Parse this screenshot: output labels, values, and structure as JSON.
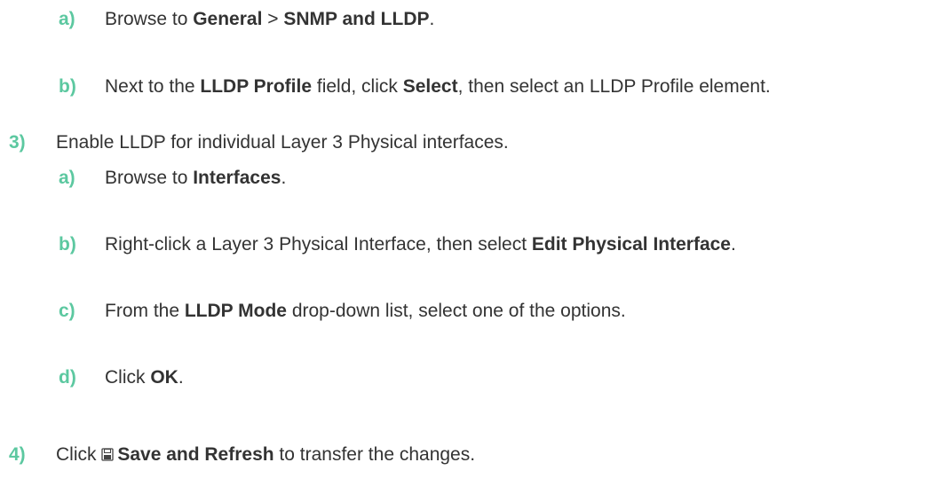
{
  "colors": {
    "marker": "#5cc8a0",
    "text": "#333333",
    "background": "#ffffff"
  },
  "steps": {
    "s2a": {
      "marker": "a)",
      "t1": "Browse to ",
      "b1": "General",
      "t2": " > ",
      "b2": "SNMP and LLDP",
      "t3": "."
    },
    "s2b": {
      "marker": "b)",
      "t1": "Next to the ",
      "b1": "LLDP Profile",
      "t2": " field, click ",
      "b2": "Select",
      "t3": ", then select an LLDP Profile element."
    },
    "s3": {
      "marker": "3)",
      "t1": "Enable LLDP for individual Layer 3 Physical interfaces."
    },
    "s3a": {
      "marker": "a)",
      "t1": "Browse to ",
      "b1": "Interfaces",
      "t2": "."
    },
    "s3b": {
      "marker": "b)",
      "t1": "Right-click a Layer 3 Physical Interface, then select ",
      "b1": "Edit Physical Interface",
      "t2": "."
    },
    "s3c": {
      "marker": "c)",
      "t1": "From the ",
      "b1": "LLDP Mode",
      "t2": " drop-down list, select one of the options."
    },
    "s3d": {
      "marker": "d)",
      "t1": "Click ",
      "b1": "OK",
      "t2": "."
    },
    "s4": {
      "marker": "4)",
      "t1": "Click ",
      "icon": "save-icon",
      "b1": "Save and Refresh",
      "t2": " to transfer the changes."
    }
  }
}
